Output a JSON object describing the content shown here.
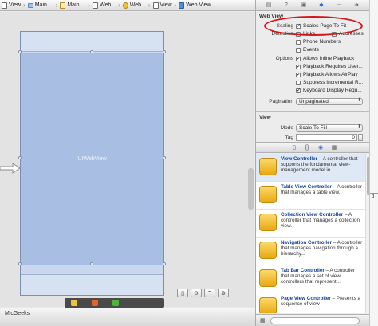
{
  "jump_bar": {
    "crumbs": [
      "View",
      "Main....",
      "Main....",
      "Web...",
      "Web...",
      "View",
      "Web View"
    ]
  },
  "canvas": {
    "webview_label": "UIWebView",
    "project_name": "MicGeeks"
  },
  "inspector": {
    "web_view_title": "Web View",
    "scaling_label": "Scaling",
    "scales_page_to_fit": "Scales Page To Fit",
    "detection_label": "Detection",
    "links": "Links",
    "addresses": "Addresses",
    "phone_numbers": "Phone Numbers",
    "events": "Events",
    "options_label": "Options",
    "allows_inline_playback": "Allows Inline Playback",
    "playback_requires_user": "Playback Requires User...",
    "playback_allows_airplay": "Playback Allows AirPlay",
    "suppress_incremental": "Suppress Incremental R...",
    "keyboard_display": "Keyboard Display Requ...",
    "pagination_label": "Pagination",
    "pagination_value": "Unpaginated",
    "view_title": "View",
    "mode_label": "Mode",
    "mode_value": "Scale To Fill",
    "tag_label": "Tag",
    "tag_value": "0"
  },
  "checks": {
    "scales_page_to_fit": true,
    "links": false,
    "addresses": false,
    "phone_numbers": false,
    "events": false,
    "allows_inline_playback": true,
    "playback_requires_user": true,
    "playback_allows_airplay": true,
    "suppress_incremental": false,
    "keyboard_display": true
  },
  "library": {
    "items": [
      {
        "name": "View Controller",
        "desc": " – A controller that supports the fundamental view-management model in..."
      },
      {
        "name": "Table View Controller",
        "desc": " – A controller that manages a table view."
      },
      {
        "name": "Collection View Controller",
        "desc": " – A controller that manages a collection view."
      },
      {
        "name": "Navigation Controller",
        "desc": " – A controller that manages navigation through a hierarchy..."
      },
      {
        "name": "Tab Bar Controller",
        "desc": " – A controller that manages a set of view controllers that represent..."
      },
      {
        "name": "Page View Controller",
        "desc": " – Presents a sequence of view"
      }
    ]
  },
  "right_strip": {
    "letter": "d"
  },
  "colors": {
    "annotation": "#d4141b",
    "webview_fill": "#a8bfe3",
    "library_name": "#0c3f92"
  }
}
